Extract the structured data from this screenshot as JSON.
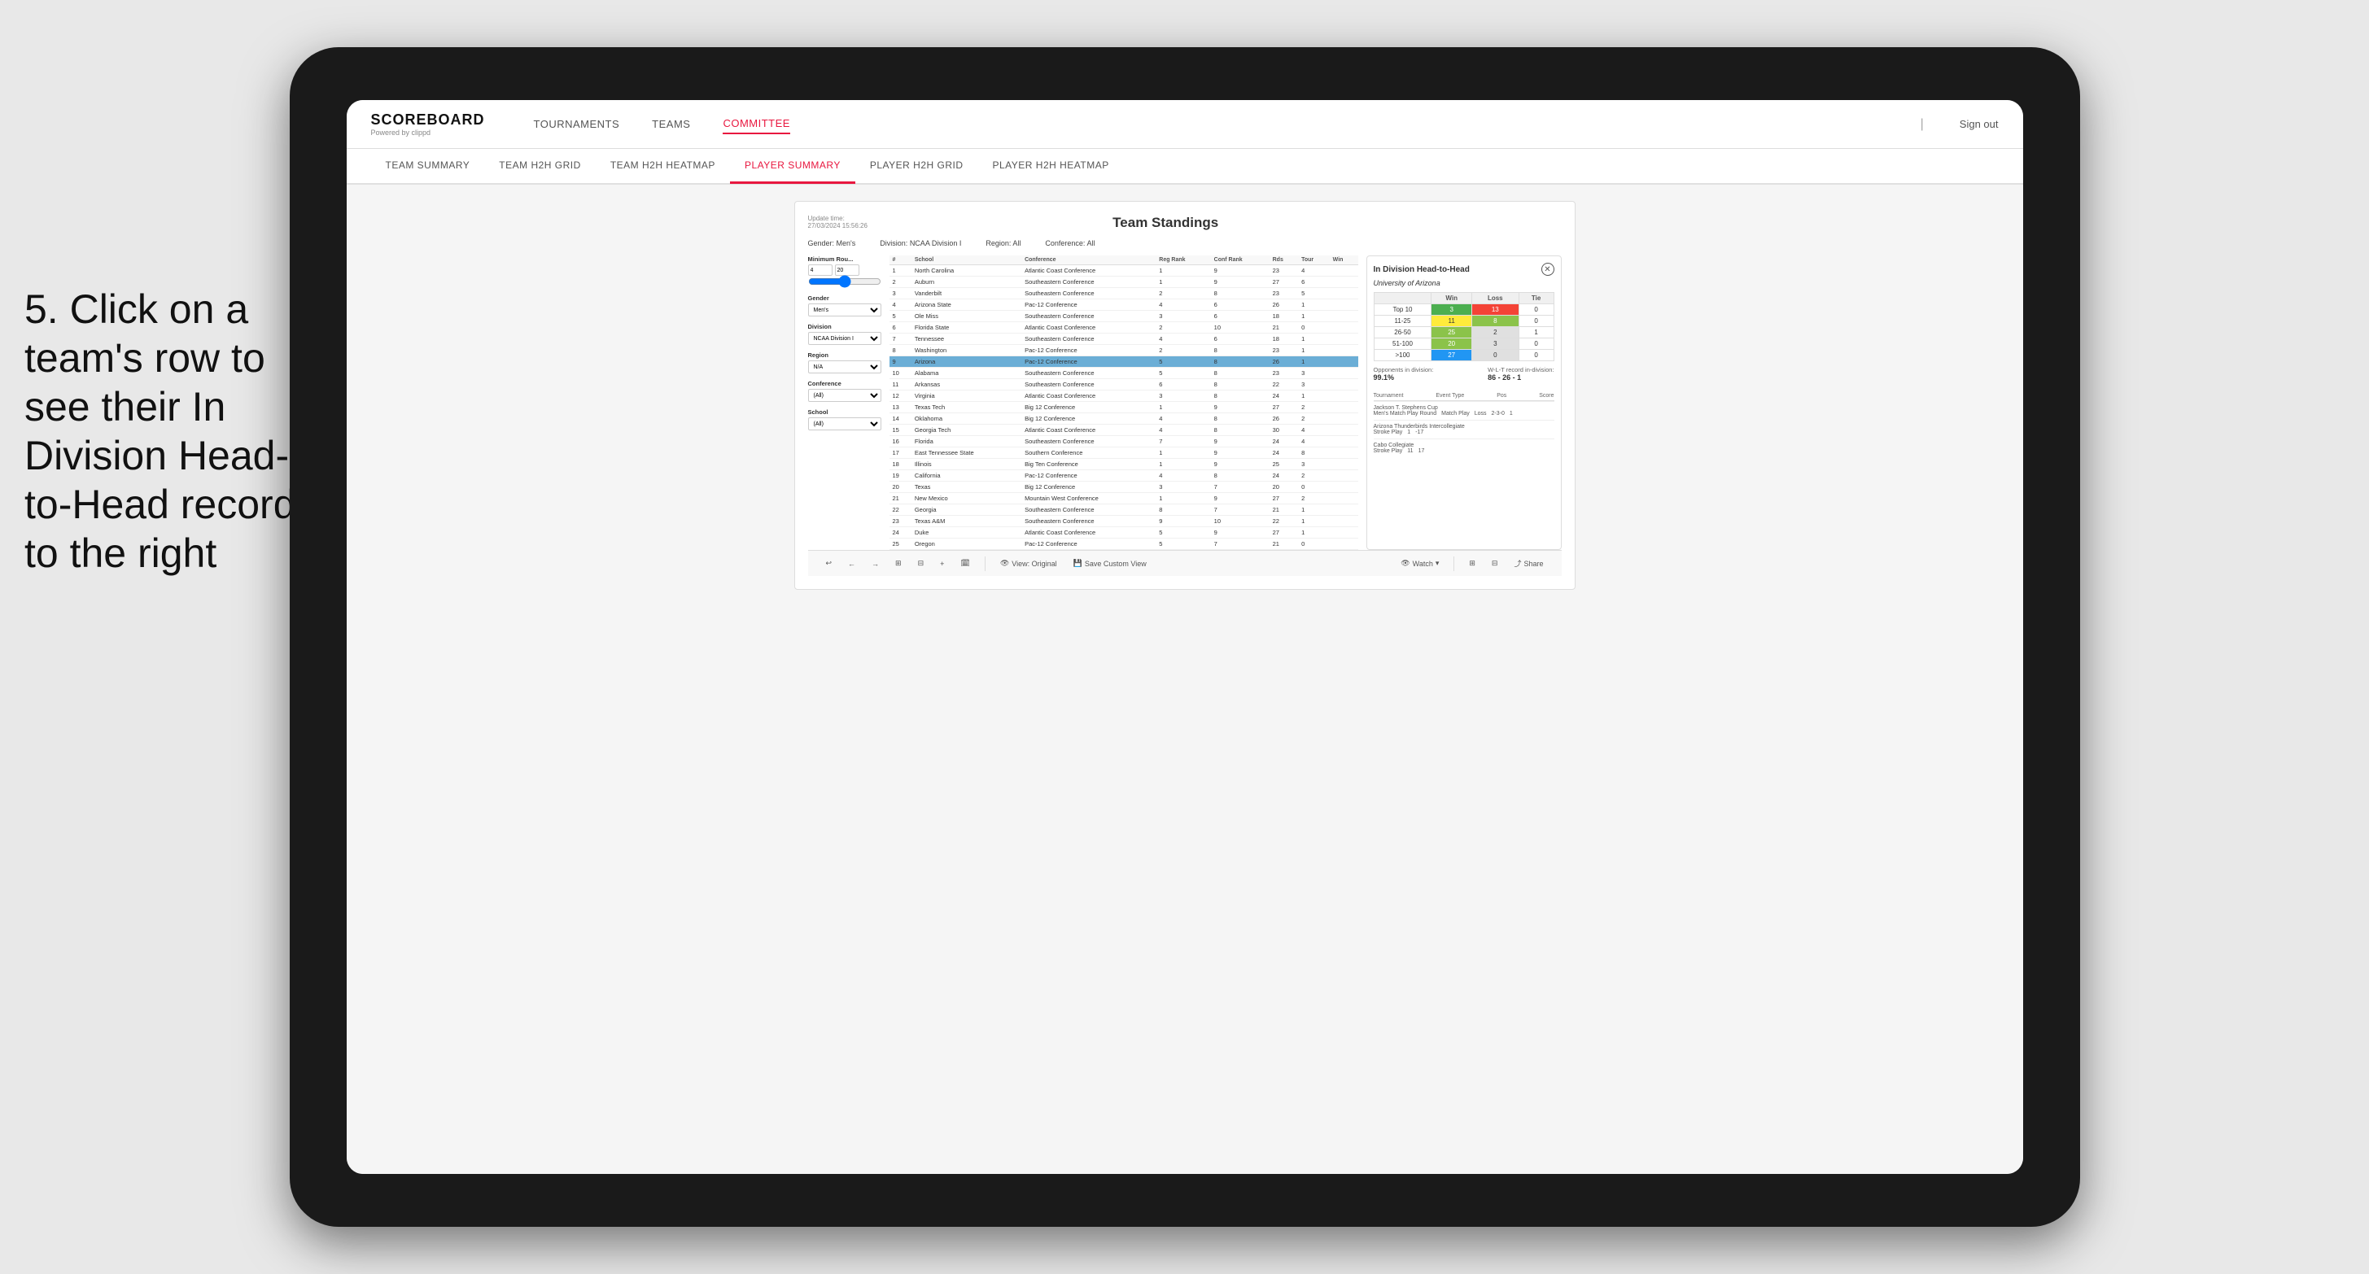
{
  "annotation": {
    "text": "5. Click on a team's row to see their In Division Head-to-Head record to the right"
  },
  "nav": {
    "logo": "SCOREBOARD",
    "logo_sub": "Powered by clippd",
    "items": [
      "TOURNAMENTS",
      "TEAMS",
      "COMMITTEE"
    ],
    "active_nav": "COMMITTEE",
    "sign_out": "Sign out"
  },
  "sub_nav": {
    "items": [
      "TEAM SUMMARY",
      "TEAM H2H GRID",
      "TEAM H2H HEATMAP",
      "PLAYER SUMMARY",
      "PLAYER H2H GRID",
      "PLAYER H2H HEATMAP"
    ],
    "active": "PLAYER SUMMARY"
  },
  "dashboard": {
    "update_time": "Update time:",
    "update_date": "27/03/2024 15:56:26",
    "title": "Team Standings",
    "gender_label": "Gender:",
    "gender_value": "Men's",
    "division_label": "Division:",
    "division_value": "NCAA Division I",
    "region_label": "Region:",
    "region_value": "All",
    "conference_label": "Conference:",
    "conference_value": "All"
  },
  "filters": {
    "min_rounds_label": "Minimum Rou...",
    "min_val": "4",
    "max_val": "20",
    "gender_label": "Gender",
    "gender_value": "Men's",
    "division_label": "Division",
    "division_value": "NCAA Division I",
    "region_label": "Region",
    "region_value": "N/A",
    "conference_label": "Conference",
    "conference_value": "(All)",
    "school_label": "School",
    "school_value": "(All)"
  },
  "table": {
    "headers": [
      "#",
      "School",
      "Conference",
      "Reg Rank",
      "Conf Rank",
      "Rds",
      "Tour",
      "Win"
    ],
    "rows": [
      {
        "rank": 1,
        "school": "North Carolina",
        "conference": "Atlantic Coast Conference",
        "reg_rank": 1,
        "conf_rank": 9,
        "rds": 23,
        "tour": 4,
        "win": null
      },
      {
        "rank": 2,
        "school": "Auburn",
        "conference": "Southeastern Conference",
        "reg_rank": 1,
        "conf_rank": 9,
        "rds": 27,
        "tour": 6,
        "win": null
      },
      {
        "rank": 3,
        "school": "Vanderbilt",
        "conference": "Southeastern Conference",
        "reg_rank": 2,
        "conf_rank": 8,
        "rds": 23,
        "tour": 5,
        "win": null
      },
      {
        "rank": 4,
        "school": "Arizona State",
        "conference": "Pac-12 Conference",
        "reg_rank": 4,
        "conf_rank": 6,
        "rds": 26,
        "tour": 1,
        "win": null
      },
      {
        "rank": 5,
        "school": "Ole Miss",
        "conference": "Southeastern Conference",
        "reg_rank": 3,
        "conf_rank": 6,
        "rds": 18,
        "tour": 1,
        "win": null
      },
      {
        "rank": 6,
        "school": "Florida State",
        "conference": "Atlantic Coast Conference",
        "reg_rank": 2,
        "conf_rank": 10,
        "rds": 21,
        "tour": 0,
        "win": null
      },
      {
        "rank": 7,
        "school": "Tennessee",
        "conference": "Southeastern Conference",
        "reg_rank": 4,
        "conf_rank": 6,
        "rds": 18,
        "tour": 1,
        "win": null
      },
      {
        "rank": 8,
        "school": "Washington",
        "conference": "Pac-12 Conference",
        "reg_rank": 2,
        "conf_rank": 8,
        "rds": 23,
        "tour": 1,
        "win": null
      },
      {
        "rank": 9,
        "school": "Arizona",
        "conference": "Pac-12 Conference",
        "reg_rank": 5,
        "conf_rank": 8,
        "rds": 26,
        "tour": 1,
        "win": null,
        "highlighted": true
      },
      {
        "rank": 10,
        "school": "Alabama",
        "conference": "Southeastern Conference",
        "reg_rank": 5,
        "conf_rank": 8,
        "rds": 23,
        "tour": 3,
        "win": null
      },
      {
        "rank": 11,
        "school": "Arkansas",
        "conference": "Southeastern Conference",
        "reg_rank": 6,
        "conf_rank": 8,
        "rds": 22,
        "tour": 3,
        "win": null
      },
      {
        "rank": 12,
        "school": "Virginia",
        "conference": "Atlantic Coast Conference",
        "reg_rank": 3,
        "conf_rank": 8,
        "rds": 24,
        "tour": 1,
        "win": null
      },
      {
        "rank": 13,
        "school": "Texas Tech",
        "conference": "Big 12 Conference",
        "reg_rank": 1,
        "conf_rank": 9,
        "rds": 27,
        "tour": 2,
        "win": null
      },
      {
        "rank": 14,
        "school": "Oklahoma",
        "conference": "Big 12 Conference",
        "reg_rank": 4,
        "conf_rank": 8,
        "rds": 26,
        "tour": 2,
        "win": null
      },
      {
        "rank": 15,
        "school": "Georgia Tech",
        "conference": "Atlantic Coast Conference",
        "reg_rank": 4,
        "conf_rank": 8,
        "rds": 30,
        "tour": 4,
        "win": null
      },
      {
        "rank": 16,
        "school": "Florida",
        "conference": "Southeastern Conference",
        "reg_rank": 7,
        "conf_rank": 9,
        "rds": 24,
        "tour": 4,
        "win": null
      },
      {
        "rank": 17,
        "school": "East Tennessee State",
        "conference": "Southern Conference",
        "reg_rank": 1,
        "conf_rank": 9,
        "rds": 24,
        "tour": 8,
        "win": null
      },
      {
        "rank": 18,
        "school": "Illinois",
        "conference": "Big Ten Conference",
        "reg_rank": 1,
        "conf_rank": 9,
        "rds": 25,
        "tour": 3,
        "win": null
      },
      {
        "rank": 19,
        "school": "California",
        "conference": "Pac-12 Conference",
        "reg_rank": 4,
        "conf_rank": 8,
        "rds": 24,
        "tour": 2,
        "win": null
      },
      {
        "rank": 20,
        "school": "Texas",
        "conference": "Big 12 Conference",
        "reg_rank": 3,
        "conf_rank": 7,
        "rds": 20,
        "tour": 0,
        "win": null
      },
      {
        "rank": 21,
        "school": "New Mexico",
        "conference": "Mountain West Conference",
        "reg_rank": 1,
        "conf_rank": 9,
        "rds": 27,
        "tour": 2,
        "win": null
      },
      {
        "rank": 22,
        "school": "Georgia",
        "conference": "Southeastern Conference",
        "reg_rank": 8,
        "conf_rank": 7,
        "rds": 21,
        "tour": 1,
        "win": null
      },
      {
        "rank": 23,
        "school": "Texas A&M",
        "conference": "Southeastern Conference",
        "reg_rank": 9,
        "conf_rank": 10,
        "rds": 22,
        "tour": 1,
        "win": null
      },
      {
        "rank": 24,
        "school": "Duke",
        "conference": "Atlantic Coast Conference",
        "reg_rank": 5,
        "conf_rank": 9,
        "rds": 27,
        "tour": 1,
        "win": null
      },
      {
        "rank": 25,
        "school": "Oregon",
        "conference": "Pac-12 Conference",
        "reg_rank": 5,
        "conf_rank": 7,
        "rds": 21,
        "tour": 0,
        "win": null
      }
    ]
  },
  "right_panel": {
    "title": "In Division Head-to-Head",
    "team": "University of Arizona",
    "h2h_rows": [
      {
        "label": "Top 10",
        "win": 3,
        "loss": 13,
        "tie": 0,
        "win_color": "green",
        "loss_color": "red"
      },
      {
        "label": "11-25",
        "win": 11,
        "loss": 8,
        "tie": 0,
        "win_color": "yellow",
        "loss_color": "light-green"
      },
      {
        "label": "26-50",
        "win": 25,
        "loss": 2,
        "tie": 1,
        "win_color": "light-green",
        "loss_color": "gray"
      },
      {
        "label": "51-100",
        "win": 20,
        "loss": 3,
        "tie": 0,
        "win_color": "light-green",
        "loss_color": "gray"
      },
      {
        "label": ">100",
        "win": 27,
        "loss": 0,
        "tie": 0,
        "win_color": "blue",
        "loss_color": "gray"
      }
    ],
    "opponents_label": "Opponents in division:",
    "opponents_value": "99.1%",
    "wlt_label": "W-L-T record in-division:",
    "wlt_value": "86 - 26 - 1",
    "tournaments": [
      {
        "name": "Jackson T. Stephens Cup",
        "event_type": "Men's Match Play Round",
        "type": "Match Play",
        "result": "Loss",
        "pos": "2-3-0",
        "score": "1"
      },
      {
        "name": "Arizona Thunderbirds Intercollegiate",
        "event_type": "",
        "type": "Stroke Play",
        "result": "",
        "pos": "1",
        "score": "-17"
      },
      {
        "name": "Cabo Collegiate",
        "event_type": "",
        "type": "Stroke Play",
        "result": "",
        "pos": "11",
        "score": "17"
      }
    ]
  },
  "toolbar": {
    "undo": "↩",
    "redo_back": "←",
    "redo_fwd": "→",
    "copy": "⊞",
    "paste": "⊟",
    "calendar": "📅",
    "view_label": "View: Original",
    "save_label": "Save Custom View",
    "watch_label": "Watch",
    "grid_label": "",
    "share_label": "Share"
  }
}
